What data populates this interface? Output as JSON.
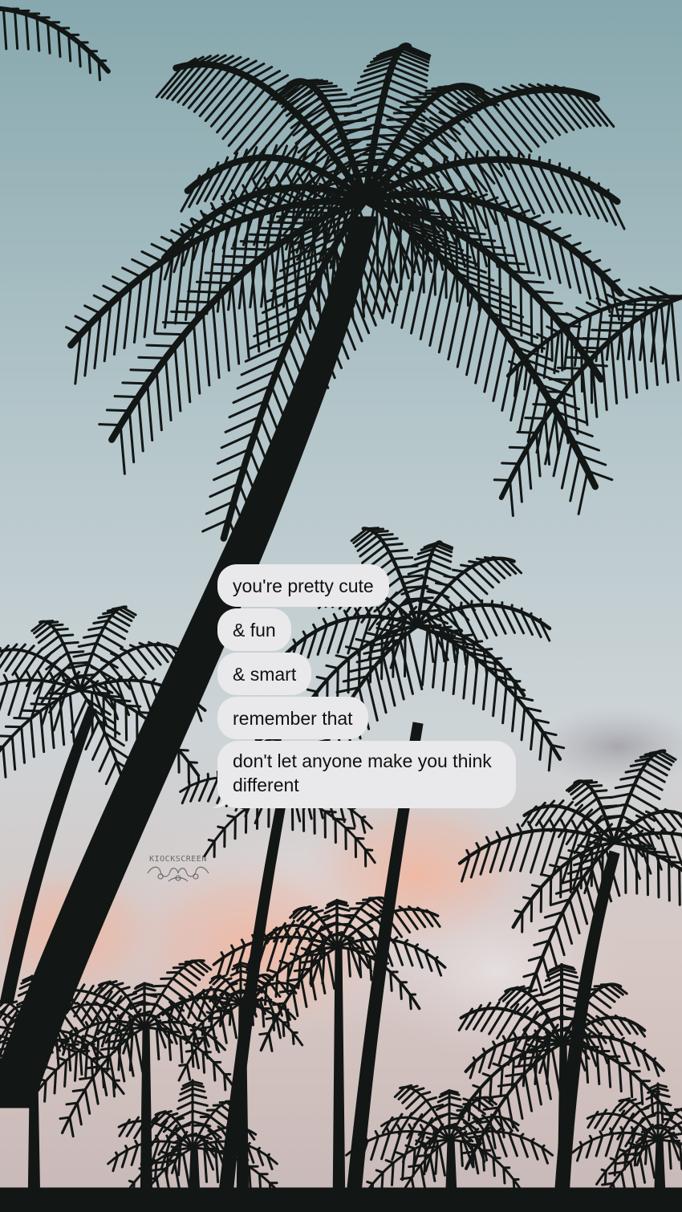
{
  "messages": [
    {
      "text": "you're pretty cute"
    },
    {
      "text": "& fun"
    },
    {
      "text": "& smart"
    },
    {
      "text": "remember that"
    },
    {
      "text": "don't let anyone make you think different"
    }
  ],
  "watermark": {
    "text": "KIOCKSCREEN"
  },
  "colors": {
    "sky_top": "#8fb0b6",
    "sky_mid": "#c9d2d6",
    "cloud_pink": "#e9b9a6",
    "silhouette": "#121615",
    "bubble": "#e9e9eb",
    "bubble_text": "#111111"
  }
}
